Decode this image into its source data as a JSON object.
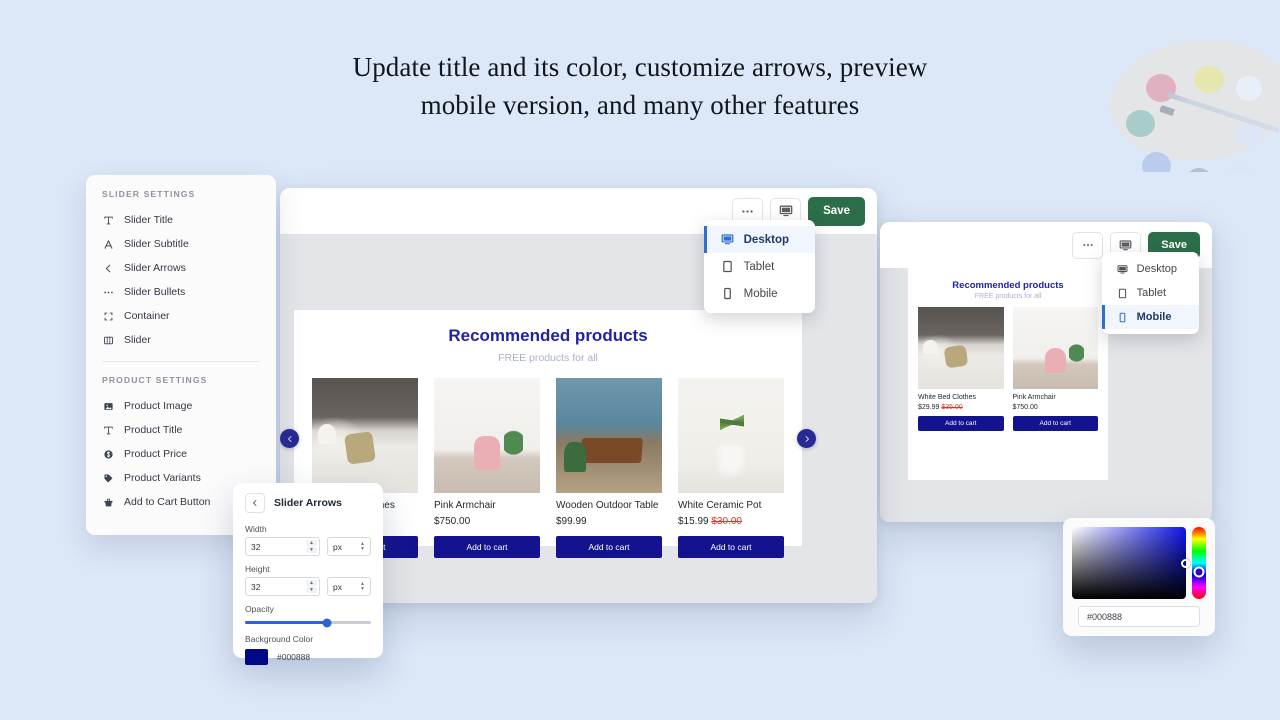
{
  "headline": {
    "line1": "Update title and its color, customize arrows, preview",
    "line2": "mobile version, and many other features"
  },
  "decoration": {
    "palette_label": "artist-palette"
  },
  "sidebar": {
    "section1_title": "SLIDER SETTINGS",
    "section1_items": [
      {
        "label": "Slider Title",
        "icon": "text-title-icon"
      },
      {
        "label": "Slider Subtitle",
        "icon": "text-subtitle-icon"
      },
      {
        "label": "Slider Arrows",
        "icon": "chevron-left-icon"
      },
      {
        "label": "Slider Bullets",
        "icon": "ellipsis-icon"
      },
      {
        "label": "Container",
        "icon": "crop-frame-icon"
      },
      {
        "label": "Slider",
        "icon": "columns-icon"
      }
    ],
    "section2_title": "PRODUCT SETTINGS",
    "section2_items": [
      {
        "label": "Product Image",
        "icon": "image-icon"
      },
      {
        "label": "Product Title",
        "icon": "text-title-icon"
      },
      {
        "label": "Product Price",
        "icon": "dollar-circle-icon"
      },
      {
        "label": "Product Variants",
        "icon": "tag-icon"
      },
      {
        "label": "Add to Cart Button",
        "icon": "cart-icon"
      }
    ]
  },
  "arrows_panel": {
    "title": "Slider Arrows",
    "back_icon": "chevron-left-icon",
    "width_label": "Width",
    "width_value": "32",
    "width_unit": "px",
    "height_label": "Height",
    "height_value": "32",
    "height_unit": "px",
    "opacity_label": "Opacity",
    "opacity_percent": 65,
    "bg_color_label": "Background Color",
    "bg_color_hex": "#000888"
  },
  "color_picker": {
    "hex_value": "#000888",
    "accent": "#000888"
  },
  "desktop_window": {
    "topbar": {
      "more_icon": "ellipsis-icon",
      "device_icon": "desktop-monitor-icon",
      "save_label": "Save",
      "save_color": "#2c6e49"
    },
    "device_menu": {
      "items": [
        {
          "label": "Desktop",
          "icon": "desktop-monitor-icon",
          "active": true
        },
        {
          "label": "Tablet",
          "icon": "tablet-icon",
          "active": false
        },
        {
          "label": "Mobile",
          "icon": "mobile-phone-icon",
          "active": false
        }
      ]
    },
    "store": {
      "title": "Recommended products",
      "subtitle": "FREE products for all",
      "title_color": "#2222a8",
      "prev_arrow_icon": "chevron-left-icon",
      "next_arrow_icon": "chevron-right-icon",
      "cart_label": "Add to cart",
      "products": [
        {
          "name": "White Bed Clothes",
          "price": "",
          "old_price": "",
          "photo": "bedroom"
        },
        {
          "name": "Pink Armchair",
          "price": "$750.00",
          "old_price": "",
          "photo": "armchair"
        },
        {
          "name": "Wooden Outdoor Table",
          "price": "$99.99",
          "old_price": "",
          "photo": "table"
        },
        {
          "name": "White Ceramic Pot",
          "price": "$15.99",
          "old_price": "$30.00",
          "photo": "pot"
        }
      ]
    }
  },
  "mobile_window": {
    "topbar": {
      "more_icon": "ellipsis-icon",
      "device_icon": "desktop-monitor-icon",
      "save_label": "Save",
      "save_color": "#2c6e49"
    },
    "device_menu": {
      "items": [
        {
          "label": "Desktop",
          "icon": "desktop-monitor-icon",
          "active": false
        },
        {
          "label": "Tablet",
          "icon": "tablet-icon",
          "active": false
        },
        {
          "label": "Mobile",
          "icon": "mobile-phone-icon",
          "active": true
        }
      ]
    },
    "store": {
      "title": "Recommended products",
      "subtitle": "FREE products for all",
      "cart_label": "Add to cart",
      "products": [
        {
          "name": "White Bed Clothes",
          "price": "$29.99",
          "old_price": "$35.00",
          "photo": "bedroom"
        },
        {
          "name": "Pink Armchair",
          "price": "$750.00",
          "old_price": "",
          "photo": "armchair"
        }
      ]
    }
  }
}
